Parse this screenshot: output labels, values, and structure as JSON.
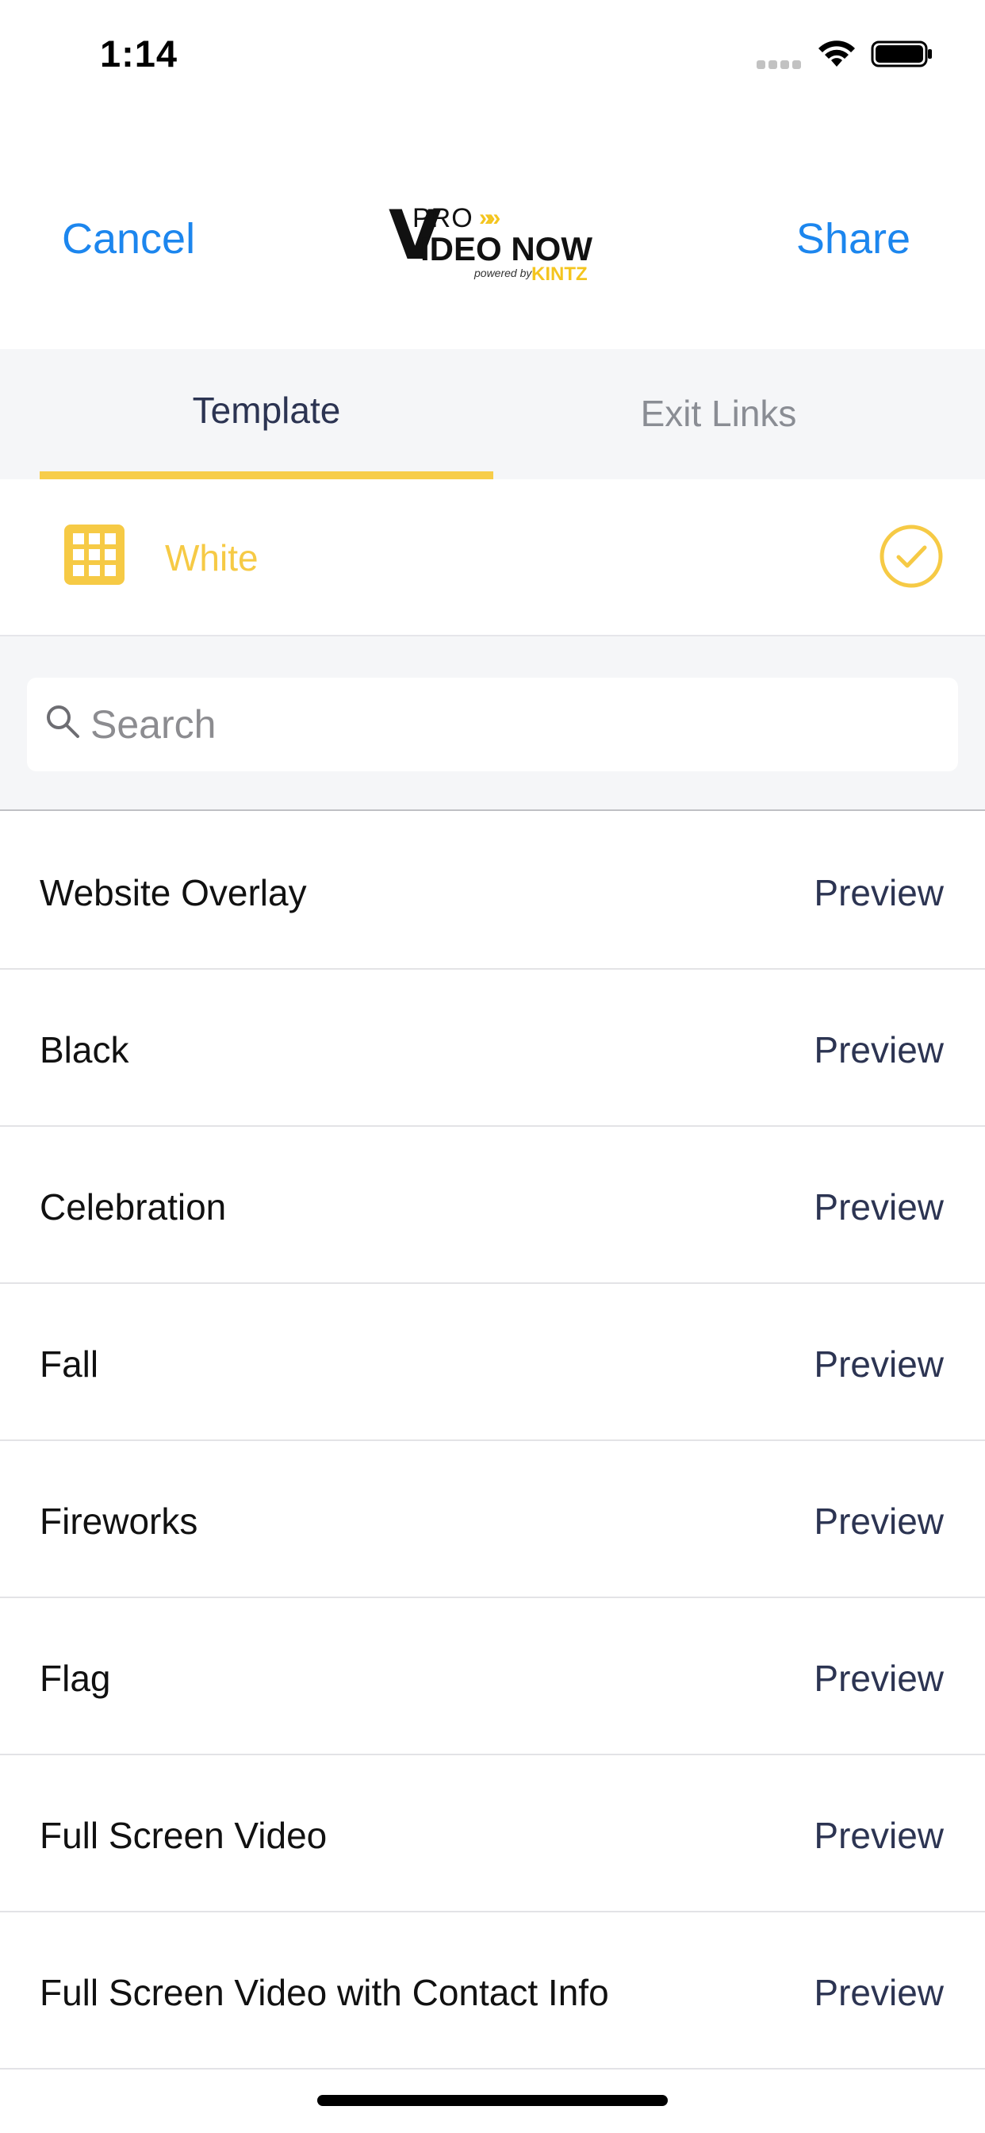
{
  "status_bar": {
    "time": "1:14"
  },
  "nav": {
    "cancel_label": "Cancel",
    "share_label": "Share",
    "logo": {
      "v": "V",
      "pro": "PRO",
      "chevrons": "»»",
      "video_now": "IDEO NOW",
      "powered_by": "powered by",
      "kintz": "KINTZ"
    }
  },
  "tabs": [
    {
      "label": "Template",
      "active": true
    },
    {
      "label": "Exit Links",
      "active": false
    }
  ],
  "selected_template": {
    "label": "White",
    "icon": "grid-icon",
    "status_icon": "checkmark-circle-icon"
  },
  "search": {
    "placeholder": "Search",
    "value": ""
  },
  "templates": [
    {
      "name": "Website Overlay",
      "action": "Preview"
    },
    {
      "name": "Black",
      "action": "Preview"
    },
    {
      "name": "Celebration",
      "action": "Preview"
    },
    {
      "name": "Fall",
      "action": "Preview"
    },
    {
      "name": "Fireworks",
      "action": "Preview"
    },
    {
      "name": "Flag",
      "action": "Preview"
    },
    {
      "name": "Full Screen Video",
      "action": "Preview"
    },
    {
      "name": "Full Screen Video with Contact Info",
      "action": "Preview"
    }
  ],
  "colors": {
    "accent_blue": "#1c86ee",
    "accent_yellow": "#f7cd4a",
    "dark_navy": "#2c3452"
  }
}
